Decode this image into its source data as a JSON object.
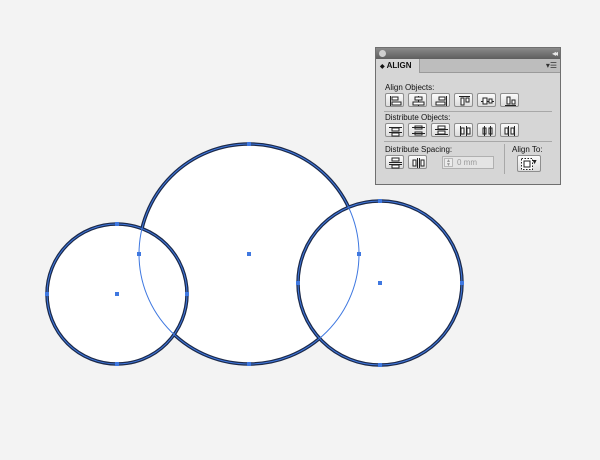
{
  "panel": {
    "tab_label": "ALIGN",
    "align_objects_label": "Align Objects:",
    "distribute_objects_label": "Distribute Objects:",
    "distribute_spacing_label": "Distribute Spacing:",
    "align_to_label": "Align To:",
    "spacing_value": "0 mm",
    "tab_arrow": "◆",
    "collapse_glyph": "◂◂",
    "menu_glyph": "▾☰"
  },
  "align_buttons": [
    "horizontal-align-left-icon",
    "horizontal-align-center-icon",
    "horizontal-align-right-icon",
    "vertical-align-top-icon",
    "vertical-align-center-icon",
    "vertical-align-bottom-icon"
  ],
  "distribute_buttons": [
    "vertical-distribute-top-icon",
    "vertical-distribute-center-icon",
    "vertical-distribute-bottom-icon",
    "horizontal-distribute-left-icon",
    "horizontal-distribute-center-icon",
    "horizontal-distribute-right-icon"
  ],
  "spacing_buttons": [
    "vertical-distribute-space-icon",
    "horizontal-distribute-space-icon"
  ],
  "colors": {
    "canvas_bg": "#f3f3f3",
    "circle_stroke": "#1c2a4a",
    "selection_blue": "#3f78e0",
    "panel_bg": "#d6d6d6"
  },
  "shapes": [
    "left-circle",
    "middle-circle",
    "right-circle"
  ]
}
